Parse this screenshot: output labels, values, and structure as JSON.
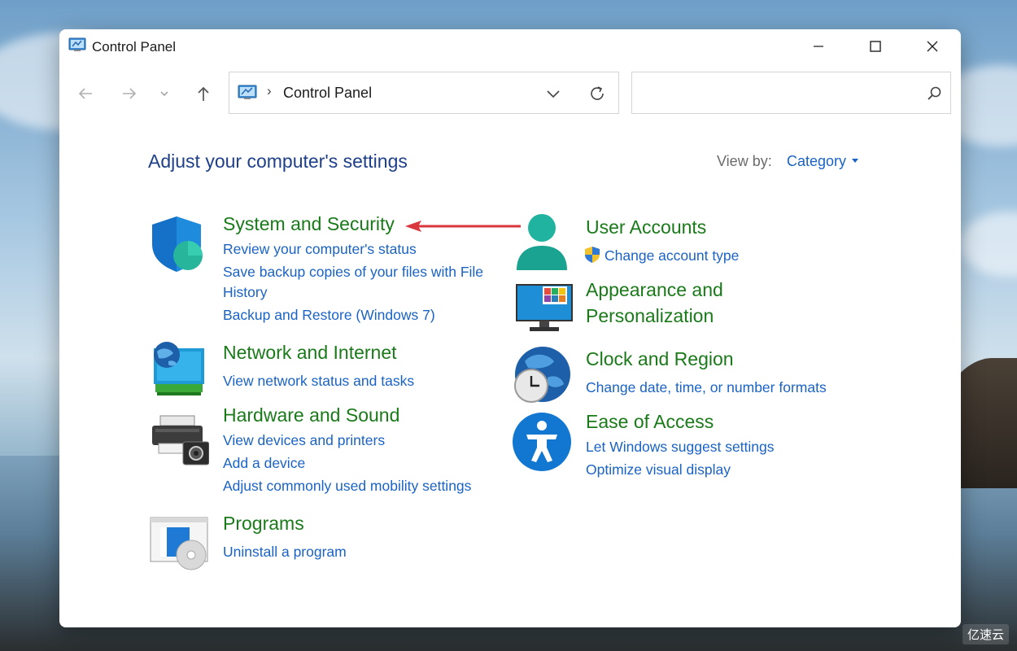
{
  "window": {
    "title": "Control Panel"
  },
  "toolbar": {
    "breadcrumb_separator": "›",
    "breadcrumb": "Control Panel",
    "search_placeholder": ""
  },
  "header": {
    "heading": "Adjust your computer's settings",
    "view_by_label": "View by:",
    "view_by_value": "Category"
  },
  "categories": {
    "system_security": {
      "title": "System and Security",
      "links": [
        "Review your computer's status",
        "Save backup copies of your files with File",
        "History",
        "Backup and Restore (Windows 7)"
      ]
    },
    "network": {
      "title": "Network and Internet",
      "links": [
        "View network status and tasks"
      ]
    },
    "hardware": {
      "title": "Hardware and Sound",
      "links": [
        "View devices and printers",
        "Add a device",
        "Adjust commonly used mobility settings"
      ]
    },
    "programs": {
      "title": "Programs",
      "links": [
        "Uninstall a program"
      ]
    },
    "user_accounts": {
      "title": "User Accounts",
      "links": [
        "Change account type"
      ]
    },
    "appearance": {
      "title_line1": "Appearance and",
      "title_line2": "Personalization"
    },
    "clock": {
      "title": "Clock and Region",
      "links": [
        "Change date, time, or number formats"
      ]
    },
    "ease": {
      "title": "Ease of Access",
      "links": [
        "Let Windows suggest settings",
        "Optimize visual display"
      ]
    }
  },
  "watermark": "亿速云",
  "colors": {
    "category_title": "#1a7a1a",
    "link": "#1a63c4",
    "heading": "#1e3f8a",
    "annotation_arrow": "#d9363e"
  },
  "icons": {
    "back": "arrow-left-icon",
    "forward": "arrow-right-icon",
    "recent": "chevron-down-icon",
    "up": "arrow-up-icon",
    "refresh": "refresh-icon",
    "search": "search-icon"
  }
}
